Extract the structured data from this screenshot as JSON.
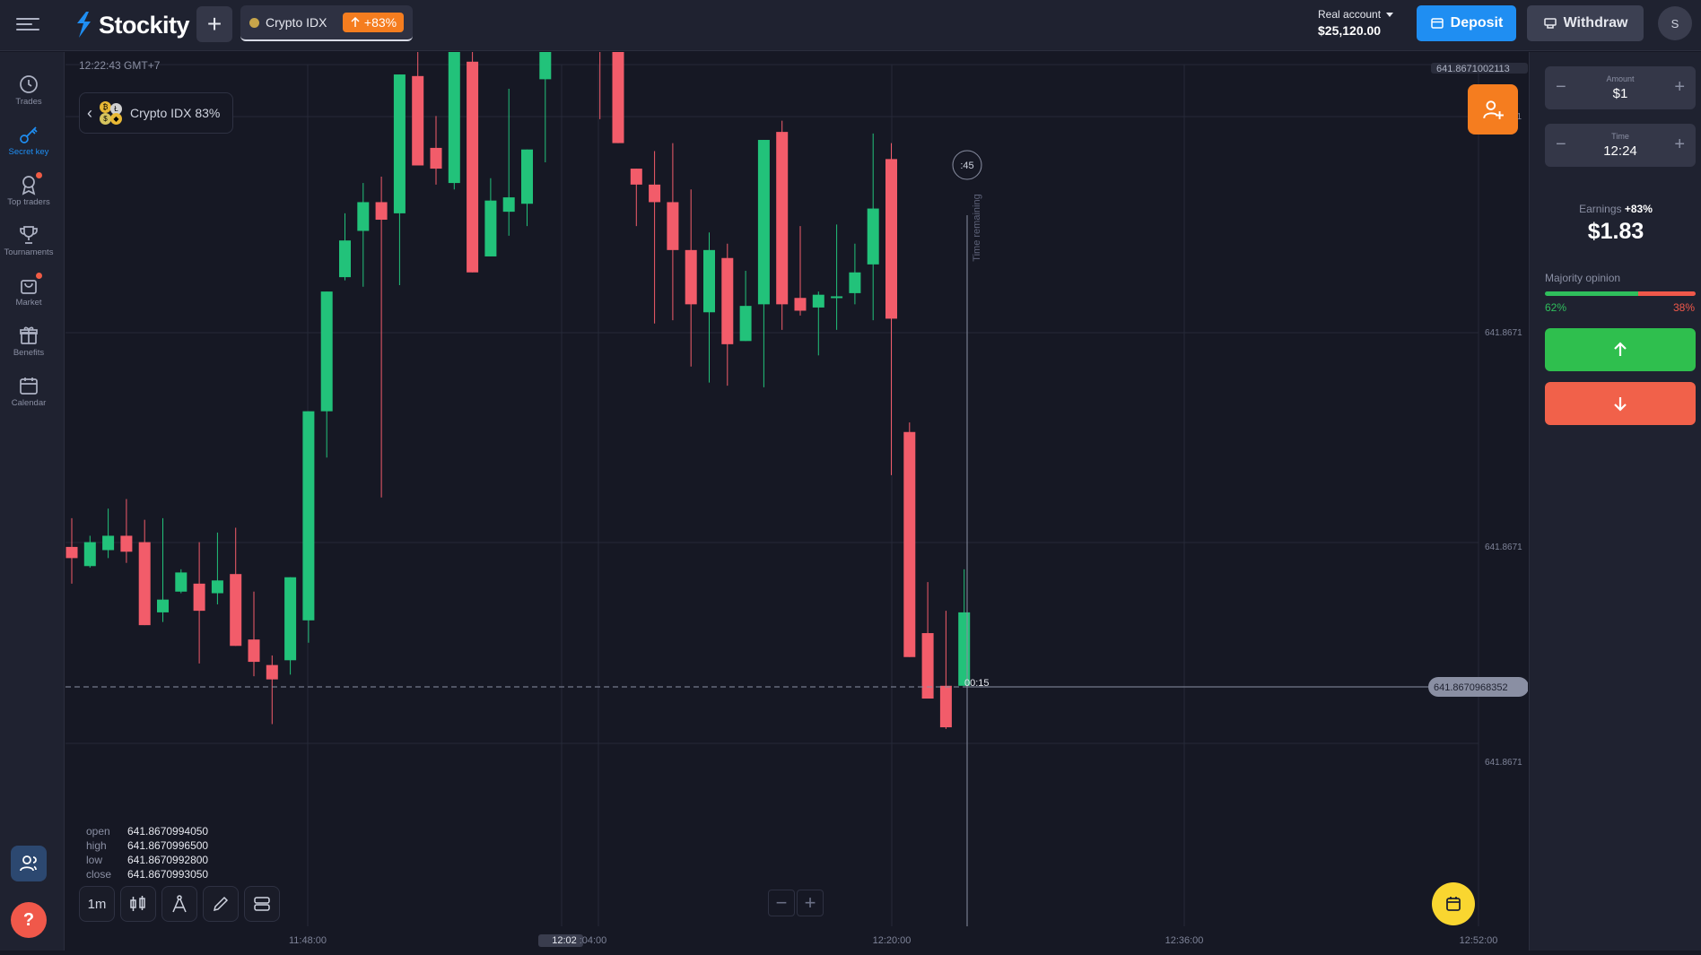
{
  "app": {
    "name": "Stockity",
    "brand_color": "#1f8ef2"
  },
  "header": {
    "tab": {
      "label": "Crypto IDX",
      "badge": "+83%"
    },
    "account": {
      "type": "Real account",
      "balance": "$25,120.00"
    },
    "deposit_label": "Deposit",
    "withdraw_label": "Withdraw",
    "avatar_initial": "S"
  },
  "sidebar": {
    "items": [
      {
        "label": "Trades",
        "icon": "clock-icon"
      },
      {
        "label": "Secret key",
        "icon": "key-icon",
        "active": true
      },
      {
        "label": "Top traders",
        "icon": "award-icon",
        "badge": true
      },
      {
        "label": "Tournaments",
        "icon": "trophy-icon"
      },
      {
        "label": "Market",
        "icon": "shopping-bag-icon",
        "badge": true
      },
      {
        "label": "Benefits",
        "icon": "gift-icon"
      },
      {
        "label": "Calendar",
        "icon": "calendar-icon"
      }
    ]
  },
  "chart": {
    "server_time": "12:22:43 GMT+7",
    "asset_label": "Crypto IDX 83%",
    "price_labels": {
      "top": "641.8671002113",
      "p1": "641.8671",
      "p2": "641.8671",
      "p3": "641.8671",
      "current": "641.8670968352",
      "top_partial": "71"
    },
    "timer": ":45",
    "time_remaining": "Time remaining",
    "countdown": "00:15",
    "time_labels": [
      "11:48:00",
      "12:02",
      ":04:00",
      "12:20:00",
      "12:36:00",
      "12:52:00"
    ],
    "ohlc": {
      "open_label": "open",
      "open": "641.8670994050",
      "high_label": "high",
      "high": "641.8670996500",
      "low_label": "low",
      "low": "641.8670992800",
      "close_label": "close",
      "close": "641.8670993050"
    },
    "timeframe": "1m"
  },
  "chart_data": {
    "type": "candlestick",
    "colors": {
      "up": "#22c27a",
      "down": "#f25c6a"
    },
    "candles": [
      {
        "o": 86,
        "h": 104,
        "l": 63,
        "c": 79
      },
      {
        "o": 74,
        "h": 93,
        "l": 73,
        "c": 89
      },
      {
        "o": 84,
        "h": 110,
        "l": 79,
        "c": 93
      },
      {
        "o": 93,
        "h": 116,
        "l": 76,
        "c": 83
      },
      {
        "o": 89,
        "h": 103,
        "l": 47,
        "c": 37
      },
      {
        "o": 45,
        "h": 104,
        "l": 39,
        "c": 53
      },
      {
        "o": 58,
        "h": 72,
        "l": 57,
        "c": 70
      },
      {
        "o": 63,
        "h": 89,
        "l": 13,
        "c": 46
      },
      {
        "o": 57,
        "h": 95,
        "l": 50,
        "c": 65
      },
      {
        "o": 69,
        "h": 98,
        "l": 30,
        "c": 24
      },
      {
        "o": 28,
        "h": 58,
        "l": 5,
        "c": 14
      },
      {
        "o": 12,
        "h": 18,
        "l": -25,
        "c": 3
      },
      {
        "o": 15,
        "h": 17,
        "l": 6,
        "c": 67
      },
      {
        "o": 40,
        "h": 139,
        "l": 26,
        "c": 171
      },
      {
        "o": 171,
        "h": 242,
        "l": 142,
        "c": 246
      },
      {
        "o": 255,
        "h": 295,
        "l": 253,
        "c": 278
      },
      {
        "o": 284,
        "h": 314,
        "l": 249,
        "c": 302
      },
      {
        "o": 302,
        "h": 318,
        "l": 117,
        "c": 291
      },
      {
        "o": 295,
        "h": 380,
        "l": 250,
        "c": 382
      },
      {
        "o": 381,
        "h": 399,
        "l": 330,
        "c": 325
      },
      {
        "o": 336,
        "h": 356,
        "l": 313,
        "c": 323
      },
      {
        "o": 314,
        "h": 406,
        "l": 310,
        "c": 405
      },
      {
        "o": 390,
        "h": 406,
        "l": 312,
        "c": 258
      },
      {
        "o": 268,
        "h": 317,
        "l": 283,
        "c": 303
      },
      {
        "o": 296,
        "h": 373,
        "l": 281,
        "c": 305
      },
      {
        "o": 301,
        "h": 335,
        "l": 287,
        "c": 335
      },
      {
        "o": 379,
        "h": 472,
        "l": 327,
        "c": 547
      },
      {
        "o": 547,
        "h": 556,
        "l": 467,
        "c": 531
      },
      {
        "o": 531,
        "h": 553,
        "l": 438,
        "c": 505
      },
      {
        "o": 481,
        "h": 486,
        "l": 354,
        "c": 397
      },
      {
        "o": 412,
        "h": 412,
        "l": 344,
        "c": 339
      },
      {
        "o": 323,
        "h": 319,
        "l": 287,
        "c": 313
      },
      {
        "o": 313,
        "h": 334,
        "l": 226,
        "c": 302
      },
      {
        "o": 302,
        "h": 339,
        "l": 228,
        "c": 272
      },
      {
        "o": 272,
        "h": 310,
        "l": 199,
        "c": 238
      },
      {
        "o": 233,
        "h": 283,
        "l": 189,
        "c": 272
      },
      {
        "o": 267,
        "h": 276,
        "l": 187,
        "c": 213
      },
      {
        "o": 215,
        "h": 259,
        "l": 222,
        "c": 237
      },
      {
        "o": 238,
        "h": 260,
        "l": 186,
        "c": 341
      },
      {
        "o": 346,
        "h": 353,
        "l": 222,
        "c": 238
      },
      {
        "o": 242,
        "h": 287,
        "l": 231,
        "c": 234
      },
      {
        "o": 236,
        "h": 246,
        "l": 206,
        "c": 244
      },
      {
        "o": 242,
        "h": 288,
        "l": 222,
        "c": 243
      },
      {
        "o": 245,
        "h": 276,
        "l": 238,
        "c": 258
      },
      {
        "o": 263,
        "h": 345,
        "l": 228,
        "c": 298
      },
      {
        "o": 329,
        "h": 339,
        "l": 131,
        "c": 229
      },
      {
        "o": 158,
        "h": 164,
        "l": 32,
        "c": 17
      },
      {
        "o": 32,
        "h": 64,
        "l": 19,
        "c": -9
      },
      {
        "o": -1,
        "h": 46,
        "l": -28,
        "c": -27
      },
      {
        "o": -1,
        "h": 72,
        "l": 51,
        "c": 45
      }
    ],
    "x_ticks": [
      "11:48:00",
      "12:04:00",
      "12:20:00",
      "12:36:00",
      "12:52:00"
    ],
    "current_price": "641.8670968352"
  },
  "panel": {
    "amount_label": "Amount",
    "amount": "$1",
    "time_label": "Time",
    "time": "12:24",
    "earnings_label": "Earnings",
    "earnings_pct": "+83%",
    "earnings": "$1.83",
    "majority_label": "Majority opinion",
    "majority_up": 62,
    "majority_up_label": "62%",
    "majority_down_label": "38%"
  }
}
